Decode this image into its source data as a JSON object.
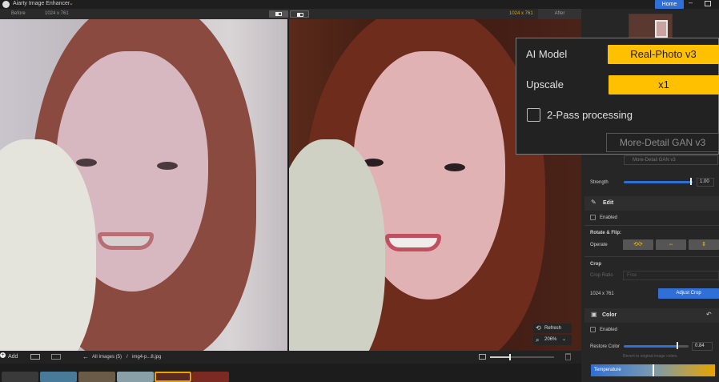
{
  "app": {
    "title": "Aiarty Image Enhancer",
    "home": "Home"
  },
  "compare": {
    "before": "Before",
    "after": "After",
    "res_left": "1024 x 761",
    "res_right": "1024 x 761"
  },
  "canvas": {
    "refresh": "Refresh",
    "zoom": "206%"
  },
  "bottom": {
    "add": "Add",
    "all_images": "All Images (5)",
    "sep": "/",
    "file": "img4-p...8.jpg"
  },
  "overlay": {
    "ai_model_label": "AI Model",
    "ai_model_value": "Real-Photo  v3",
    "upscale_label": "Upscale",
    "upscale_value": "x1",
    "two_pass_label": "2-Pass processing",
    "gan_model": "More-Detail GAN  v3"
  },
  "sidebar": {
    "gan_small": "More-Detail GAN  v3",
    "strength_label": "Strength",
    "strength_value": "1.00",
    "edit_title": "Edit",
    "edit_enabled": "Enabled",
    "rotate_flip": "Rotate & Flip:",
    "operate": "Operate",
    "crop_title": "Crop",
    "crop_ratio": "Crop Ratio",
    "crop_ratio_value": "Free",
    "crop_size": "1024 x 761",
    "adjust_crop": "Adjust Crop",
    "color_title": "Color",
    "color_enabled": "Enabled",
    "restore_color": "Restore Color",
    "restore_value": "0.84",
    "revert_hint": "Revert to original image colors",
    "temperature": "Temperature",
    "strength_level": 1.0,
    "restore_level": 0.84
  },
  "colors": {
    "accent_yellow": "#ffc000",
    "accent_blue": "#2f6fd6"
  }
}
